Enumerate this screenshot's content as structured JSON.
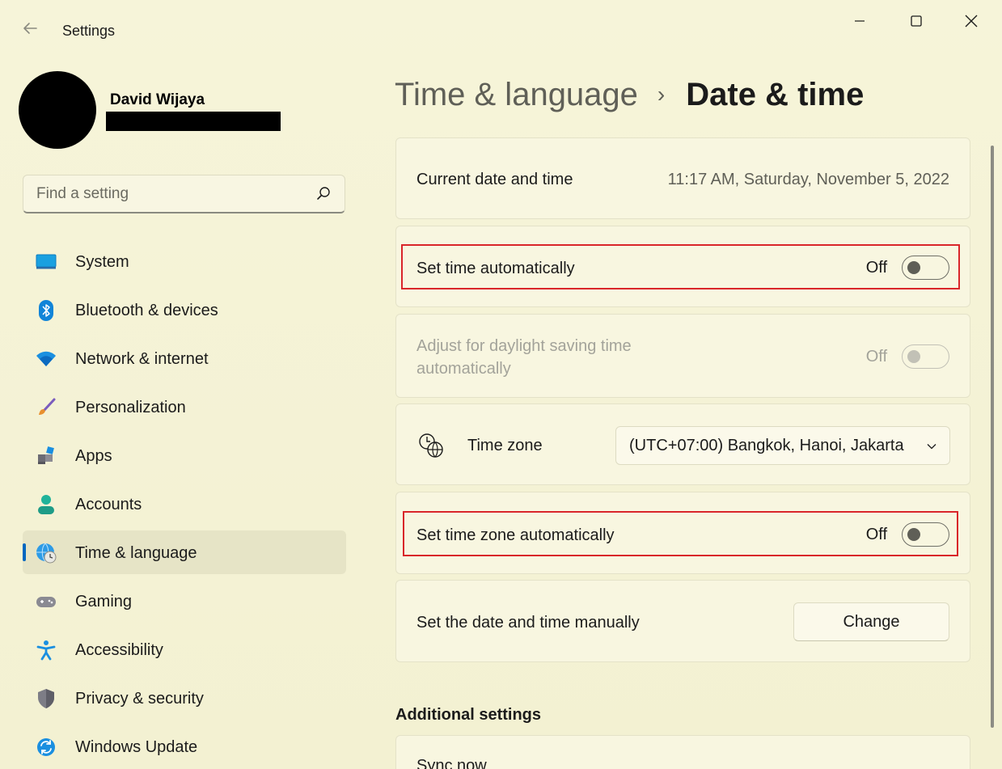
{
  "window": {
    "title": "Settings",
    "controls": [
      "minimize",
      "maximize",
      "close"
    ]
  },
  "profile": {
    "name": "David Wijaya"
  },
  "search": {
    "placeholder": "Find a setting"
  },
  "sidebar": {
    "items": [
      {
        "label": "System",
        "icon": "system-icon",
        "active": false
      },
      {
        "label": "Bluetooth & devices",
        "icon": "bluetooth-icon",
        "active": false
      },
      {
        "label": "Network & internet",
        "icon": "wifi-icon",
        "active": false
      },
      {
        "label": "Personalization",
        "icon": "brush-icon",
        "active": false
      },
      {
        "label": "Apps",
        "icon": "apps-icon",
        "active": false
      },
      {
        "label": "Accounts",
        "icon": "accounts-icon",
        "active": false
      },
      {
        "label": "Time & language",
        "icon": "globe-clock-icon",
        "active": true
      },
      {
        "label": "Gaming",
        "icon": "gamepad-icon",
        "active": false
      },
      {
        "label": "Accessibility",
        "icon": "accessibility-icon",
        "active": false
      },
      {
        "label": "Privacy & security",
        "icon": "shield-icon",
        "active": false
      },
      {
        "label": "Windows Update",
        "icon": "update-icon",
        "active": false
      }
    ]
  },
  "header": {
    "parent": "Time & language",
    "separator": "›",
    "current": "Date & time"
  },
  "cards": {
    "current_datetime": {
      "label": "Current date and time",
      "value": "11:17 AM, Saturday, November 5, 2022"
    },
    "set_time_auto": {
      "label": "Set time automatically",
      "state": "Off",
      "on": false,
      "highlighted": true
    },
    "daylight_saving": {
      "label_line1": "Adjust for daylight saving time",
      "label_line2": "automatically",
      "state": "Off",
      "on": false,
      "disabled": true
    },
    "time_zone": {
      "label": "Time zone",
      "value": "(UTC+07:00) Bangkok, Hanoi, Jakarta"
    },
    "set_timezone_auto": {
      "label": "Set time zone automatically",
      "state": "Off",
      "on": false,
      "highlighted": true
    },
    "manual": {
      "label": "Set the date and time manually",
      "button": "Change"
    }
  },
  "additional": {
    "heading": "Additional settings",
    "sync_label": "Sync now"
  },
  "colors": {
    "accent": "#0067c0",
    "highlight_border": "#d9262a"
  }
}
